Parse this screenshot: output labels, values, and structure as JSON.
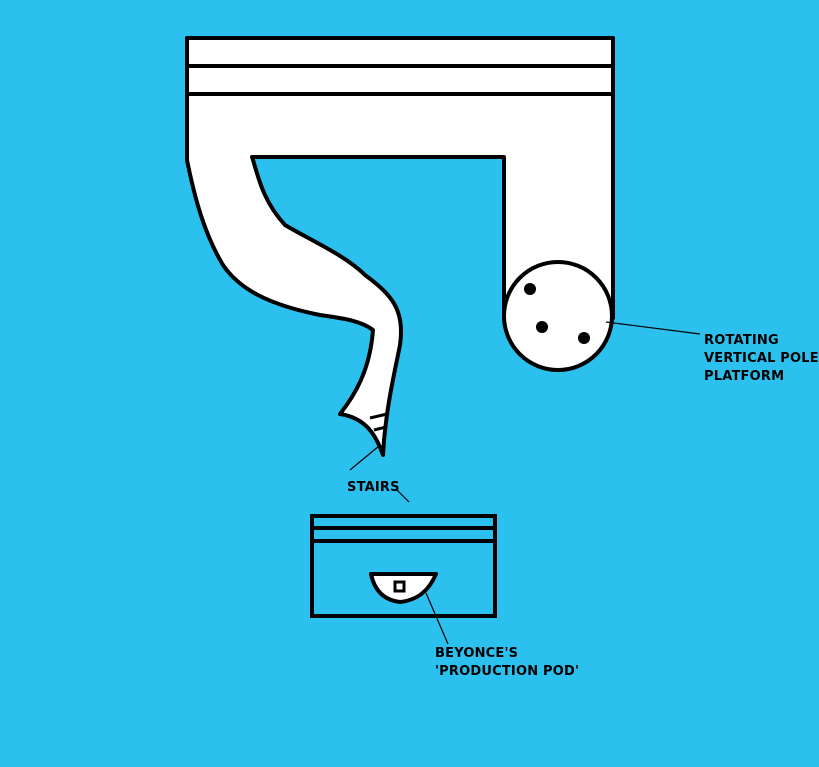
{
  "colors": {
    "background": "#2bc0ee",
    "structure_fill": "#ffffff",
    "outline": "#000000"
  },
  "labels": {
    "rotating_platform": [
      "ROTATING",
      "VERTICAL POLE",
      "PLATFORM"
    ],
    "stairs": "STAIRS",
    "production_pod": [
      "BEYONCE'S",
      "'PRODUCTION POD'"
    ]
  }
}
